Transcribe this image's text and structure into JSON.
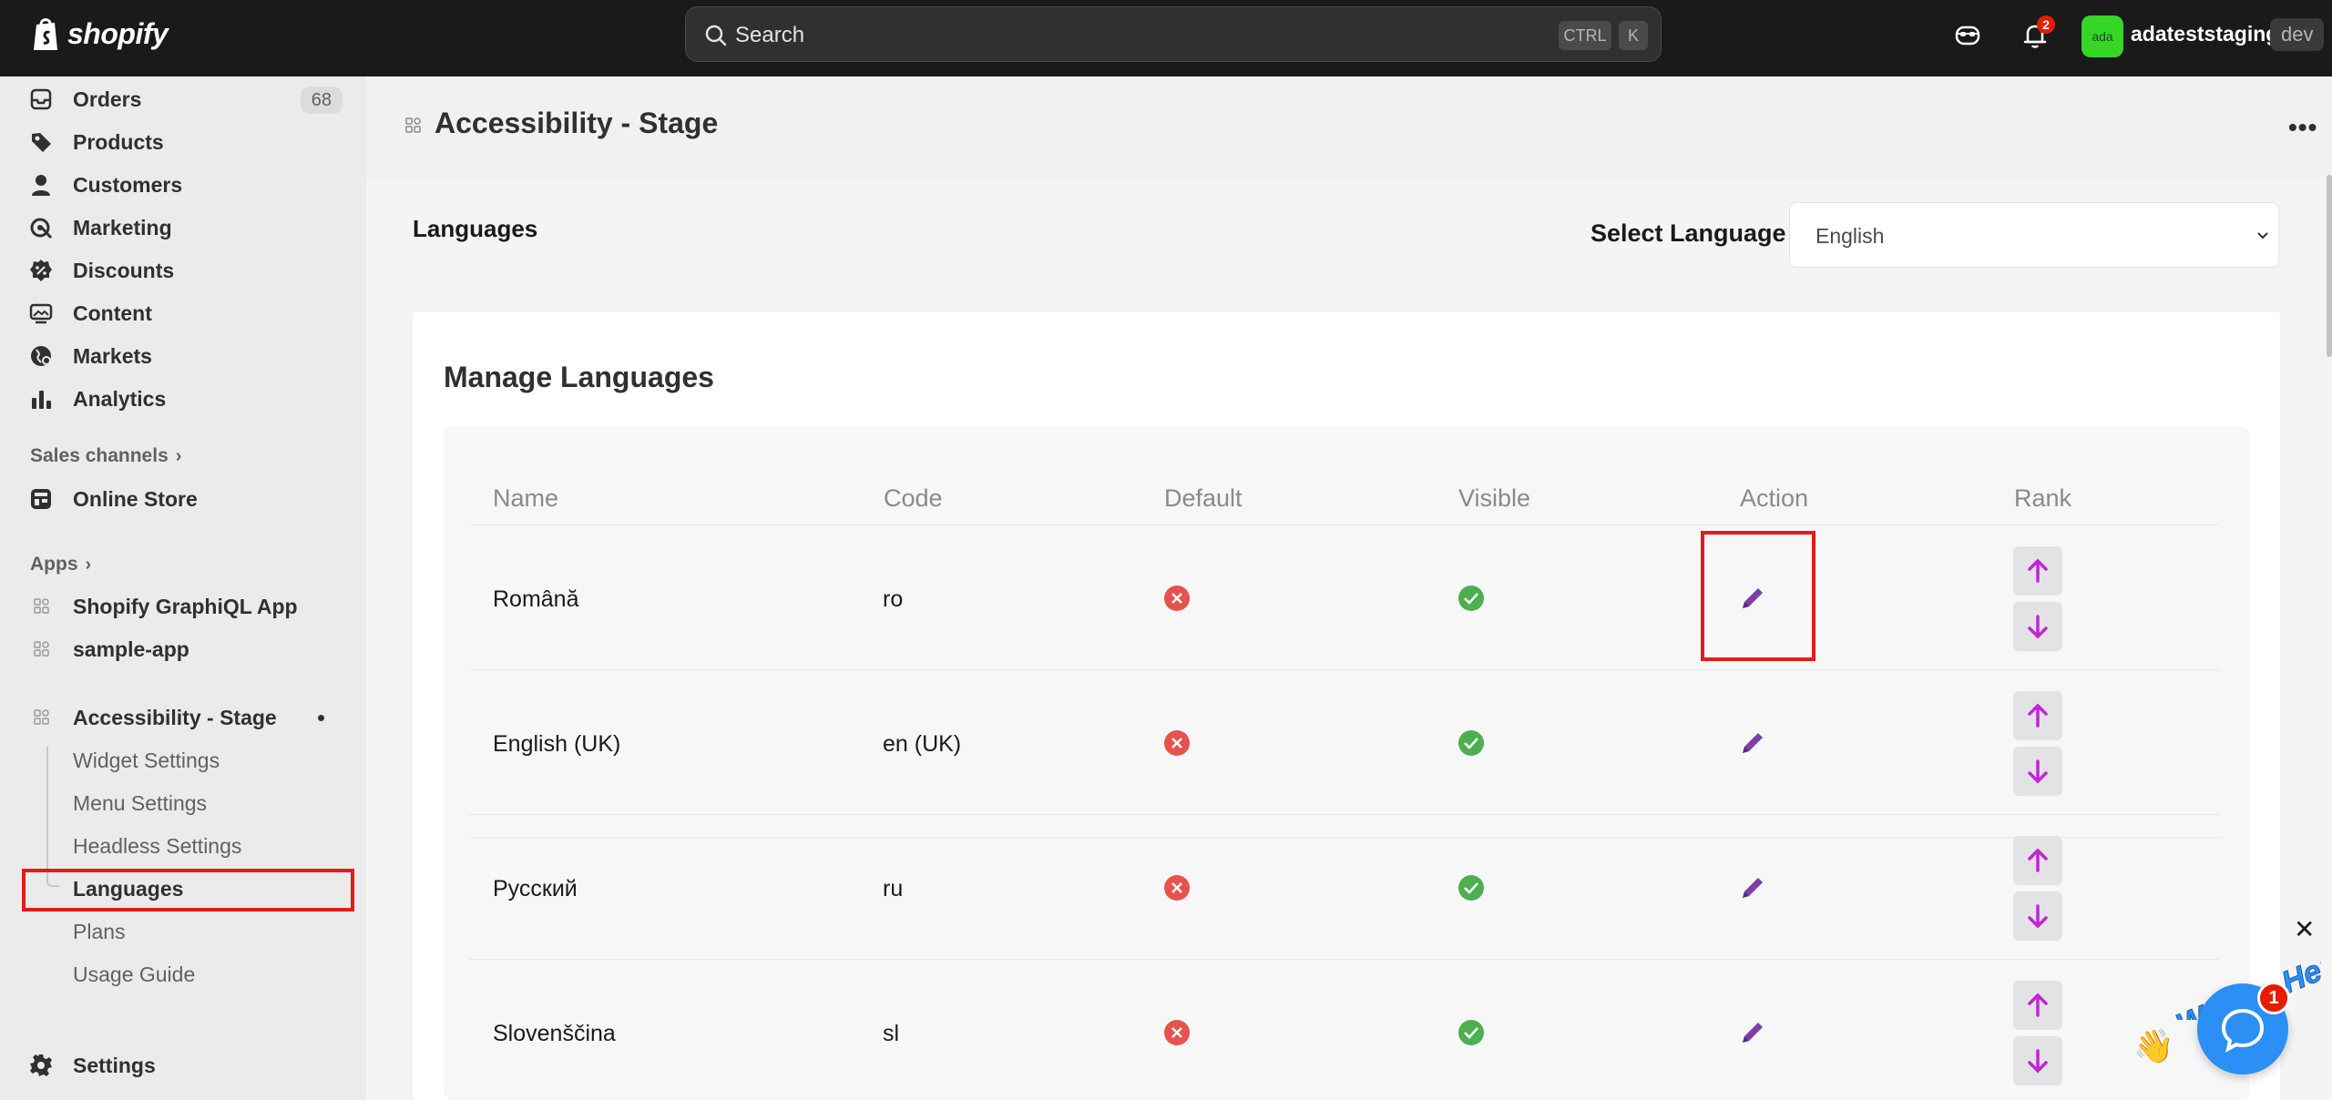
{
  "topbar": {
    "logo_text": "shopify",
    "search_placeholder": "Search",
    "shortcut_ctrl": "CTRL",
    "shortcut_k": "K",
    "notification_count": "2",
    "store_avatar": "ada",
    "store_name": "adateststaging",
    "store_tag": "dev"
  },
  "sidebar": {
    "main_items": [
      {
        "label": "Orders",
        "icon": "inbox-icon",
        "count": "68"
      },
      {
        "label": "Products",
        "icon": "tag-icon"
      },
      {
        "label": "Customers",
        "icon": "person-icon"
      },
      {
        "label": "Marketing",
        "icon": "target-icon"
      },
      {
        "label": "Discounts",
        "icon": "discount-icon"
      },
      {
        "label": "Content",
        "icon": "content-icon"
      },
      {
        "label": "Markets",
        "icon": "globe-icon"
      },
      {
        "label": "Analytics",
        "icon": "bar-chart-icon"
      }
    ],
    "sales_channels_heading": "Sales channels",
    "online_store": "Online Store",
    "apps_heading": "Apps",
    "apps": [
      "Shopify GraphiQL App",
      "sample-app",
      "Accessibility - Stage"
    ],
    "sub_items": [
      "Widget Settings",
      "Menu Settings",
      "Headless Settings",
      "Languages",
      "Plans",
      "Usage Guide"
    ],
    "settings": "Settings"
  },
  "page": {
    "title": "Accessibility - Stage",
    "more": "•••",
    "languages_heading": "Languages",
    "select_label": "Select Language",
    "select_value": "English",
    "card_title": "Manage Languages"
  },
  "table": {
    "columns": [
      "Name",
      "Code",
      "Default",
      "Visible",
      "Action",
      "Rank"
    ],
    "rows": [
      {
        "name": "Română",
        "code": "ro",
        "default": false,
        "visible": true
      },
      {
        "name": "English (UK)",
        "code": "en (UK)",
        "default": false,
        "visible": true
      },
      {
        "name": "Русский",
        "code": "ru",
        "default": false,
        "visible": true
      },
      {
        "name": "Slovenščina",
        "code": "sl",
        "default": false,
        "visible": true
      }
    ]
  },
  "chat": {
    "close": "✕",
    "banner": "We Are Here!",
    "badge": "1"
  },
  "colors": {
    "topbar": "#1a1a1a",
    "highlight": "#e41b1b",
    "edit": "#7b3fa8",
    "rank_arrow": "#c026d3",
    "default_no": "#e5534b",
    "visible_yes": "#4caf50",
    "chat": "#2b8ff5"
  }
}
